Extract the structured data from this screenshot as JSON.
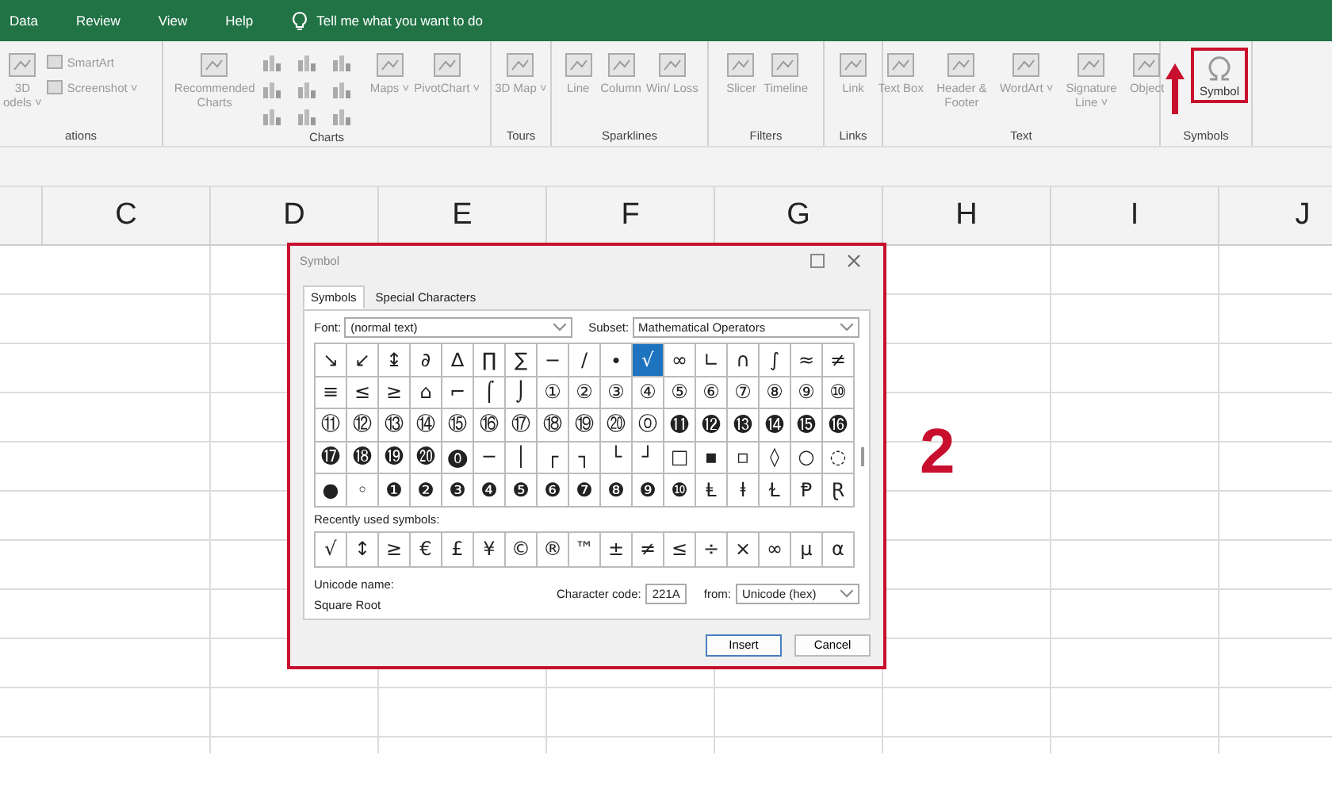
{
  "menu_tabs": [
    {
      "label": "Data"
    },
    {
      "label": "Review"
    },
    {
      "label": "View"
    },
    {
      "label": "Help"
    }
  ],
  "tell_me": "Tell me what you want to do",
  "ribbon_groups": [
    {
      "label": "ations",
      "items": [
        {
          "kind": "large",
          "label": "3D\nodels ˅"
        },
        {
          "kind": "small",
          "label": "SmartArt"
        },
        {
          "kind": "small",
          "label": "Screenshot ˅"
        }
      ]
    },
    {
      "label": "Charts",
      "items": [
        {
          "kind": "large",
          "label": "Recommended Charts"
        },
        {
          "kind": "chart-icons"
        },
        {
          "kind": "large",
          "label": "Maps ˅"
        },
        {
          "kind": "large",
          "label": "PivotChart ˅"
        }
      ]
    },
    {
      "label": "Tours",
      "items": [
        {
          "kind": "large",
          "label": "3D Map ˅"
        }
      ]
    },
    {
      "label": "Sparklines",
      "items": [
        {
          "kind": "large",
          "label": "Line"
        },
        {
          "kind": "large",
          "label": "Column"
        },
        {
          "kind": "large",
          "label": "Win/ Loss"
        }
      ]
    },
    {
      "label": "Filters",
      "items": [
        {
          "kind": "large",
          "label": "Slicer"
        },
        {
          "kind": "large",
          "label": "Timeline"
        }
      ]
    },
    {
      "label": "Links",
      "items": [
        {
          "kind": "large",
          "label": "Link"
        }
      ]
    },
    {
      "label": "Text",
      "items": [
        {
          "kind": "large",
          "label": "Text Box"
        },
        {
          "kind": "large",
          "label": "Header & Footer"
        },
        {
          "kind": "large",
          "label": "WordArt ˅"
        },
        {
          "kind": "large",
          "label": "Signature Line ˅"
        },
        {
          "kind": "large",
          "label": "Object"
        }
      ]
    },
    {
      "label": "Symbols",
      "items": [
        {
          "kind": "arrow"
        },
        {
          "kind": "symbol",
          "label": "Symbol"
        }
      ]
    }
  ],
  "columns": [
    "C",
    "D",
    "E",
    "F",
    "G",
    "H",
    "I",
    "J"
  ],
  "dialog": {
    "title": "Symbol",
    "tabs": [
      {
        "label": "Symbols",
        "selected": true
      },
      {
        "label": "Special Characters",
        "selected": false
      }
    ],
    "font_label": "Font:",
    "font_value": "(normal text)",
    "subset_label": "Subset:",
    "subset_value": "Mathematical Operators",
    "symbols": [
      {
        "char": "↘",
        "selected": false
      },
      {
        "char": "↙",
        "selected": false
      },
      {
        "char": "↨",
        "selected": false
      },
      {
        "char": "∂",
        "selected": false
      },
      {
        "char": "∆",
        "selected": false
      },
      {
        "char": "∏",
        "selected": false
      },
      {
        "char": "∑",
        "selected": false
      },
      {
        "char": "−",
        "selected": false
      },
      {
        "char": "∕",
        "selected": false
      },
      {
        "char": "∙",
        "selected": false
      },
      {
        "char": "√",
        "selected": true
      },
      {
        "char": "∞",
        "selected": false
      },
      {
        "char": "∟",
        "selected": false
      },
      {
        "char": "∩",
        "selected": false
      },
      {
        "char": "∫",
        "selected": false
      },
      {
        "char": "≈",
        "selected": false
      },
      {
        "char": "≠",
        "selected": false
      },
      {
        "char": "≡",
        "selected": false
      },
      {
        "char": "≤",
        "selected": false
      },
      {
        "char": "≥",
        "selected": false
      },
      {
        "char": "⌂",
        "selected": false
      },
      {
        "char": "⌐",
        "selected": false
      },
      {
        "char": "⌠",
        "selected": false
      },
      {
        "char": "⌡",
        "selected": false
      },
      {
        "char": "①",
        "selected": false
      },
      {
        "char": "②",
        "selected": false
      },
      {
        "char": "③",
        "selected": false
      },
      {
        "char": "④",
        "selected": false
      },
      {
        "char": "⑤",
        "selected": false
      },
      {
        "char": "⑥",
        "selected": false
      },
      {
        "char": "⑦",
        "selected": false
      },
      {
        "char": "⑧",
        "selected": false
      },
      {
        "char": "⑨",
        "selected": false
      },
      {
        "char": "⑩",
        "selected": false
      },
      {
        "char": "⑪",
        "selected": false
      },
      {
        "char": "⑫",
        "selected": false
      },
      {
        "char": "⑬",
        "selected": false
      },
      {
        "char": "⑭",
        "selected": false
      },
      {
        "char": "⑮",
        "selected": false
      },
      {
        "char": "⑯",
        "selected": false
      },
      {
        "char": "⑰",
        "selected": false
      },
      {
        "char": "⑱",
        "selected": false
      },
      {
        "char": "⑲",
        "selected": false
      },
      {
        "char": "⑳",
        "selected": false
      },
      {
        "char": "⓪",
        "selected": false
      },
      {
        "char": "⓫",
        "selected": false
      },
      {
        "char": "⓬",
        "selected": false
      },
      {
        "char": "⓭",
        "selected": false
      },
      {
        "char": "⓮",
        "selected": false
      },
      {
        "char": "⓯",
        "selected": false
      },
      {
        "char": "⓰",
        "selected": false
      },
      {
        "char": "⓱",
        "selected": false
      },
      {
        "char": "⓲",
        "selected": false
      },
      {
        "char": "⓳",
        "selected": false
      },
      {
        "char": "⓴",
        "selected": false
      },
      {
        "char": "⓿",
        "selected": false
      },
      {
        "char": "─",
        "selected": false
      },
      {
        "char": "│",
        "selected": false
      },
      {
        "char": "┌",
        "selected": false
      },
      {
        "char": "┐",
        "selected": false
      },
      {
        "char": "└",
        "selected": false
      },
      {
        "char": "┘",
        "selected": false
      },
      {
        "char": "□",
        "selected": false
      },
      {
        "char": "▪",
        "selected": false
      },
      {
        "char": "▫",
        "selected": false
      },
      {
        "char": "◊",
        "selected": false
      },
      {
        "char": "○",
        "selected": false
      },
      {
        "char": "◌",
        "selected": false
      },
      {
        "char": "●",
        "selected": false
      },
      {
        "char": "◦",
        "selected": false
      },
      {
        "char": "❶",
        "selected": false
      },
      {
        "char": "❷",
        "selected": false
      },
      {
        "char": "❸",
        "selected": false
      },
      {
        "char": "❹",
        "selected": false
      },
      {
        "char": "❺",
        "selected": false
      },
      {
        "char": "❻",
        "selected": false
      },
      {
        "char": "❼",
        "selected": false
      },
      {
        "char": "❽",
        "selected": false
      },
      {
        "char": "❾",
        "selected": false
      },
      {
        "char": "❿",
        "selected": false
      },
      {
        "char": "Ⱡ",
        "selected": false
      },
      {
        "char": "ⱡ",
        "selected": false
      },
      {
        "char": "Ɫ",
        "selected": false
      },
      {
        "char": "Ᵽ",
        "selected": false
      },
      {
        "char": "Ɽ",
        "selected": false
      }
    ],
    "recent_label": "Recently used symbols:",
    "recent": [
      "√",
      "↕",
      "≥",
      "€",
      "£",
      "¥",
      "©",
      "®",
      "™",
      "±",
      "≠",
      "≤",
      "÷",
      "×",
      "∞",
      "µ",
      "α"
    ],
    "unicode_name_label": "Unicode name:",
    "unicode_name": "Square Root",
    "char_code_label": "Character code:",
    "char_code": "221A",
    "from_label": "from:",
    "from_value": "Unicode (hex)",
    "buttons": [
      "Insert",
      "Cancel"
    ]
  },
  "annotation": "2"
}
